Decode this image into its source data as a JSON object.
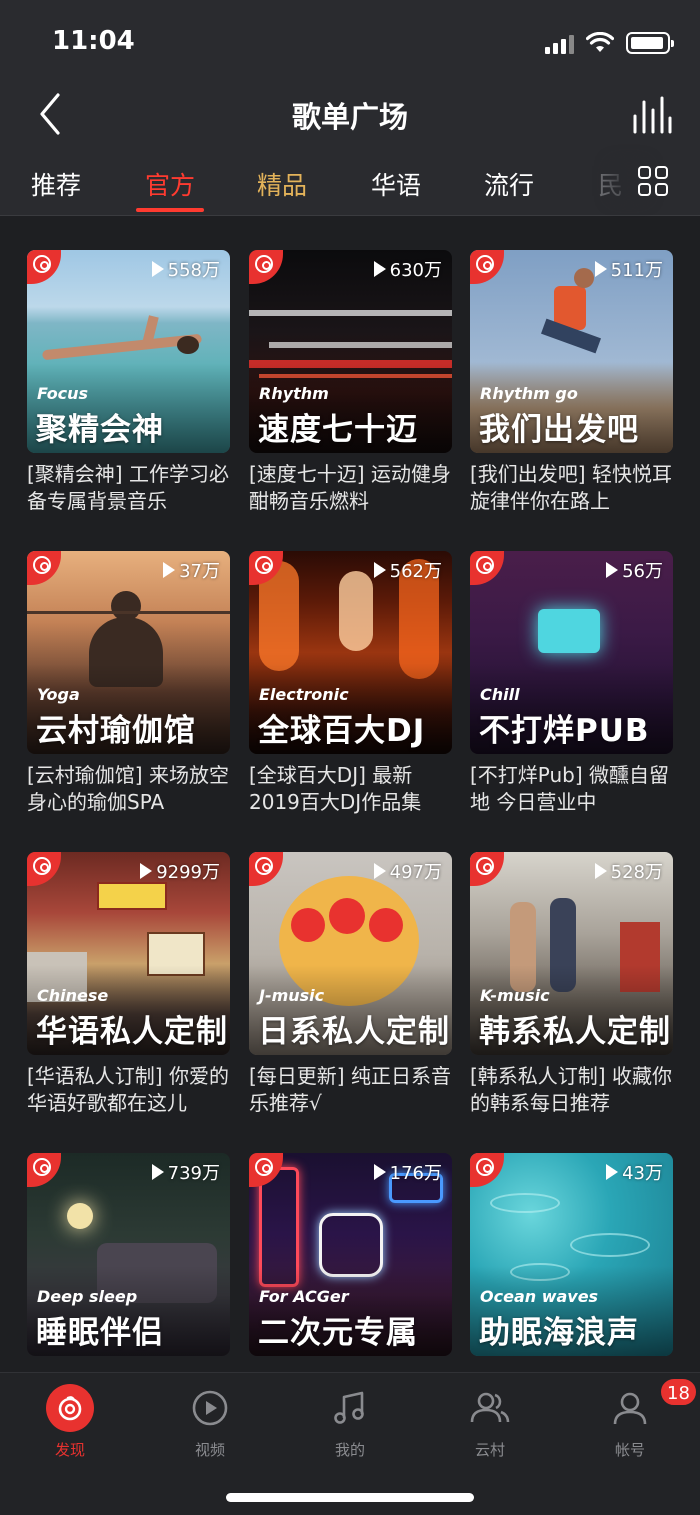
{
  "status_bar": {
    "time": "11:04"
  },
  "header": {
    "title": "歌单广场"
  },
  "tabs": [
    {
      "label": "推荐"
    },
    {
      "label": "官方"
    },
    {
      "label": "精品"
    },
    {
      "label": "华语"
    },
    {
      "label": "流行"
    },
    {
      "label": "民"
    }
  ],
  "active_tab": "官方",
  "playlists": [
    {
      "plays": "558万",
      "tag_en": "Focus",
      "tag_cn": "聚精会神",
      "desc": "[聚精会神] 工作学习必备专属背景音乐"
    },
    {
      "plays": "630万",
      "tag_en": "Rhythm",
      "tag_cn": "速度七十迈",
      "desc": "[速度七十迈] 运动健身酣畅音乐燃料"
    },
    {
      "plays": "511万",
      "tag_en": "Rhythm go",
      "tag_cn": "我们出发吧",
      "desc": "[我们出发吧] 轻快悦耳旋律伴你在路上"
    },
    {
      "plays": "37万",
      "tag_en": "Yoga",
      "tag_cn": "云村瑜伽馆",
      "desc": "[云村瑜伽馆] 来场放空身心的瑜伽SPA"
    },
    {
      "plays": "562万",
      "tag_en": "Electronic",
      "tag_cn": "全球百大DJ",
      "desc": "[全球百大DJ] 最新2019百大DJ作品集"
    },
    {
      "plays": "56万",
      "tag_en": "Chill",
      "tag_cn": "不打烊PUB",
      "desc": "[不打烊Pub] 微醺自留地 今日营业中"
    },
    {
      "plays": "9299万",
      "tag_en": "Chinese",
      "tag_cn": "华语私人定制",
      "desc": "[华语私人订制] 你爱的华语好歌都在这儿"
    },
    {
      "plays": "497万",
      "tag_en": "J-music",
      "tag_cn": "日系私人定制",
      "desc": "[每日更新] 纯正日系音乐推荐√"
    },
    {
      "plays": "528万",
      "tag_en": "K-music",
      "tag_cn": "韩系私人定制",
      "desc": "[韩系私人订制] 收藏你的韩系每日推荐"
    },
    {
      "plays": "739万",
      "tag_en": "Deep sleep",
      "tag_cn": "睡眠伴侣",
      "desc": ""
    },
    {
      "plays": "176万",
      "tag_en": "For ACGer",
      "tag_cn": "二次元专属",
      "desc": ""
    },
    {
      "plays": "43万",
      "tag_en": "Ocean waves",
      "tag_cn": "助眠海浪声",
      "desc": ""
    }
  ],
  "bottom_nav": [
    {
      "label": "发现",
      "icon": "discover-icon"
    },
    {
      "label": "视频",
      "icon": "video-icon"
    },
    {
      "label": "我的",
      "icon": "music-note-icon"
    },
    {
      "label": "云村",
      "icon": "friends-icon"
    },
    {
      "label": "帐号",
      "icon": "account-icon",
      "badge": "18"
    }
  ],
  "colors": {
    "accent": "#e8322f",
    "background": "#1e1f22",
    "gold_tab": "#e3b35a"
  }
}
